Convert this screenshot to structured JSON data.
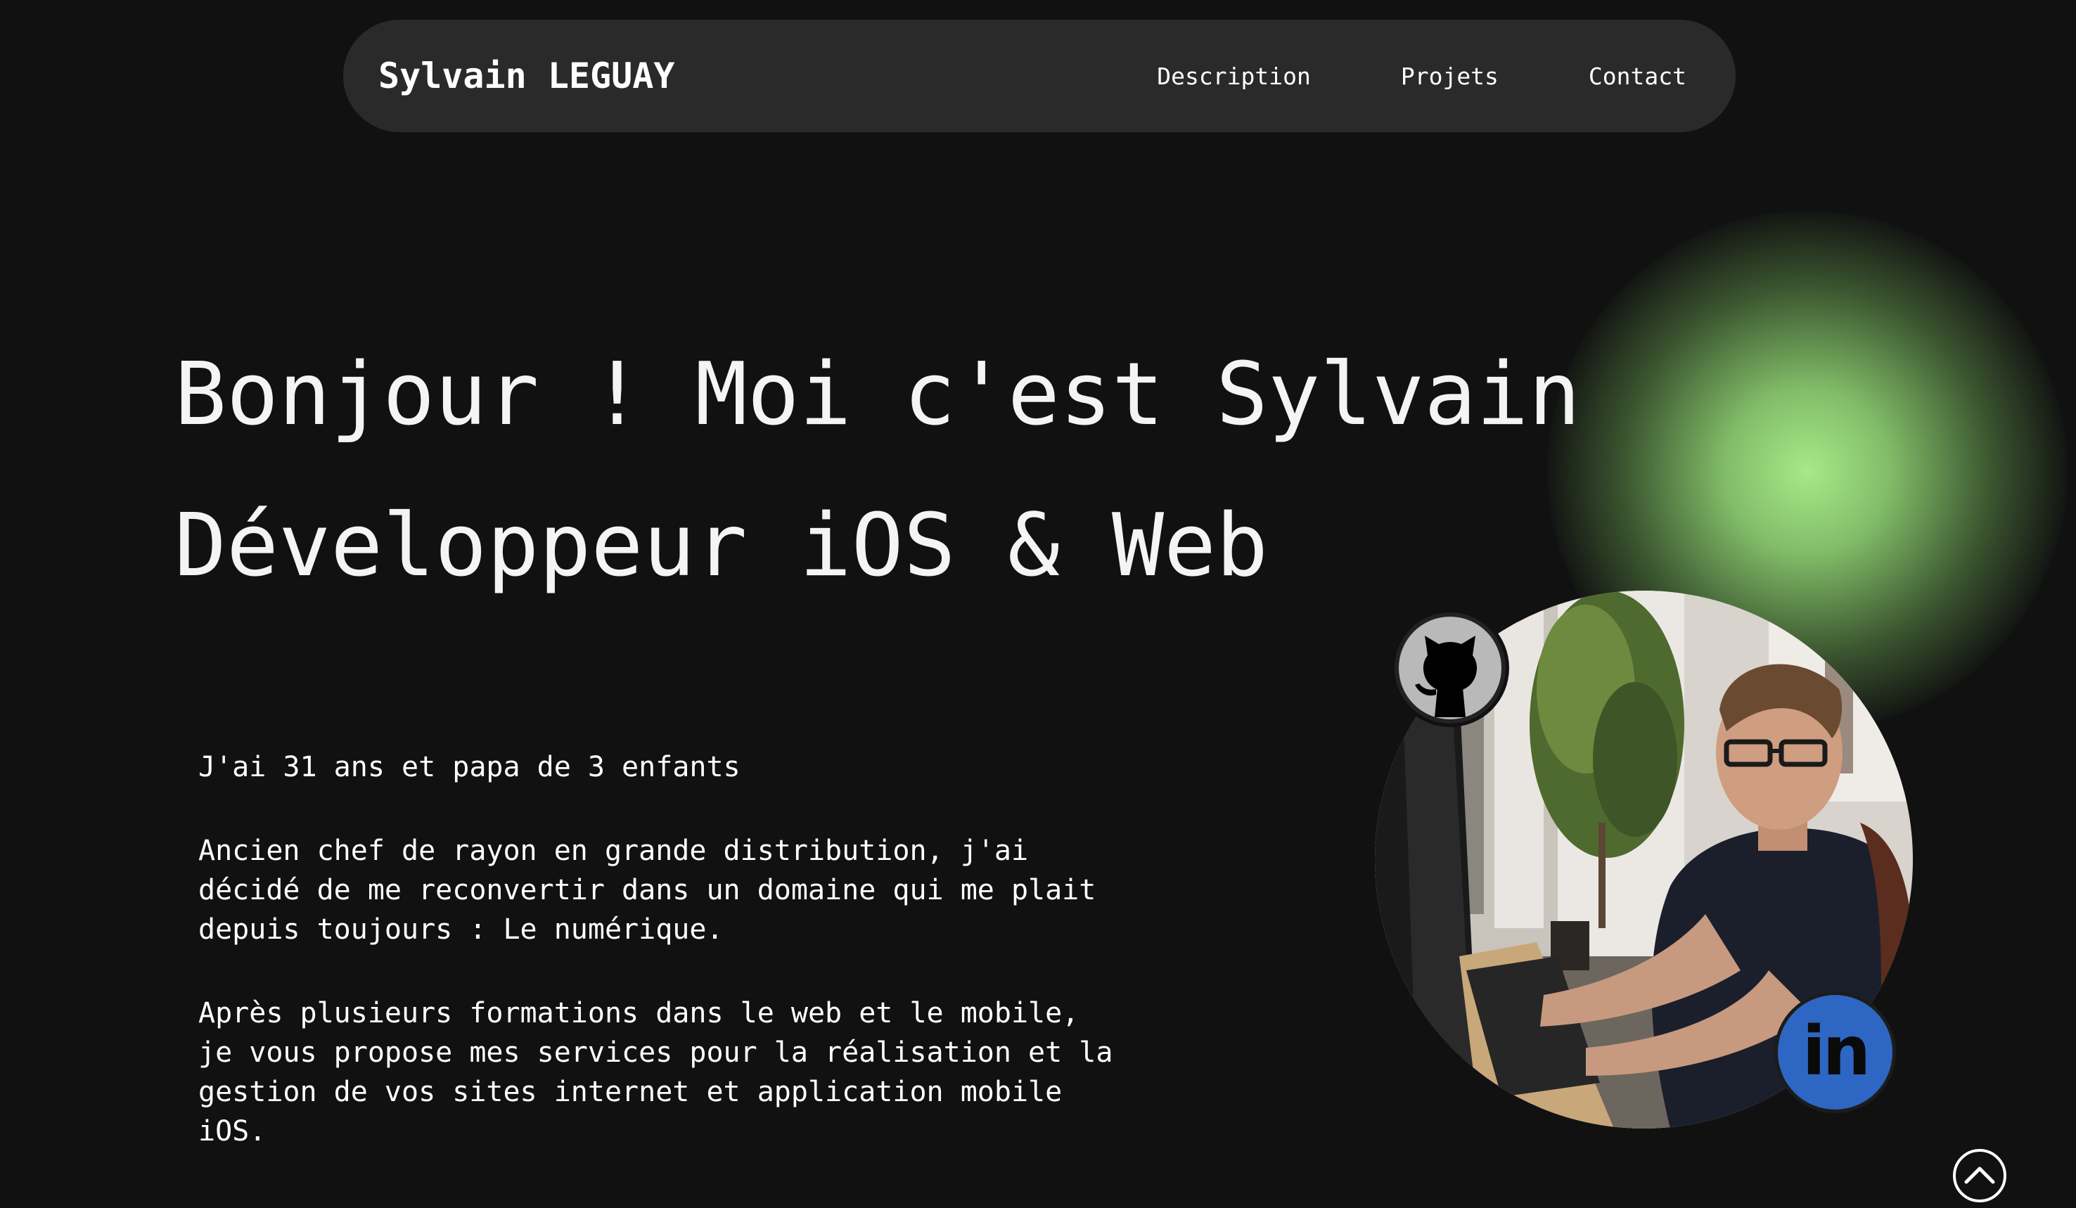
{
  "header": {
    "brand": "Sylvain LEGUAY",
    "nav": [
      {
        "label": "Description"
      },
      {
        "label": "Projets"
      },
      {
        "label": "Contact"
      }
    ]
  },
  "hero": {
    "line1": "Bonjour ! Moi c'est Sylvain",
    "line2": "Développeur iOS & Web"
  },
  "bio": {
    "p1": "J'ai 31 ans et papa de 3 enfants",
    "p2": "Ancien chef de rayon en grande distribution, j'ai décidé de me reconvertir dans un domaine qui me plait depuis toujours : Le numérique.",
    "p3": "Après plusieurs formations dans le web et le mobile, je vous propose mes services pour la réalisation et la gestion de vos sites internet et application mobile iOS."
  },
  "social": {
    "github_icon": "github-octocat-icon",
    "linkedin_label": "in",
    "linkedin_icon": "linkedin-icon"
  },
  "scroll_top_icon": "chevron-up-circle-icon",
  "colors": {
    "background": "#111111",
    "navbar": "#2a2a2a",
    "glow": "#a7e889",
    "linkedin": "#2e66c3"
  }
}
